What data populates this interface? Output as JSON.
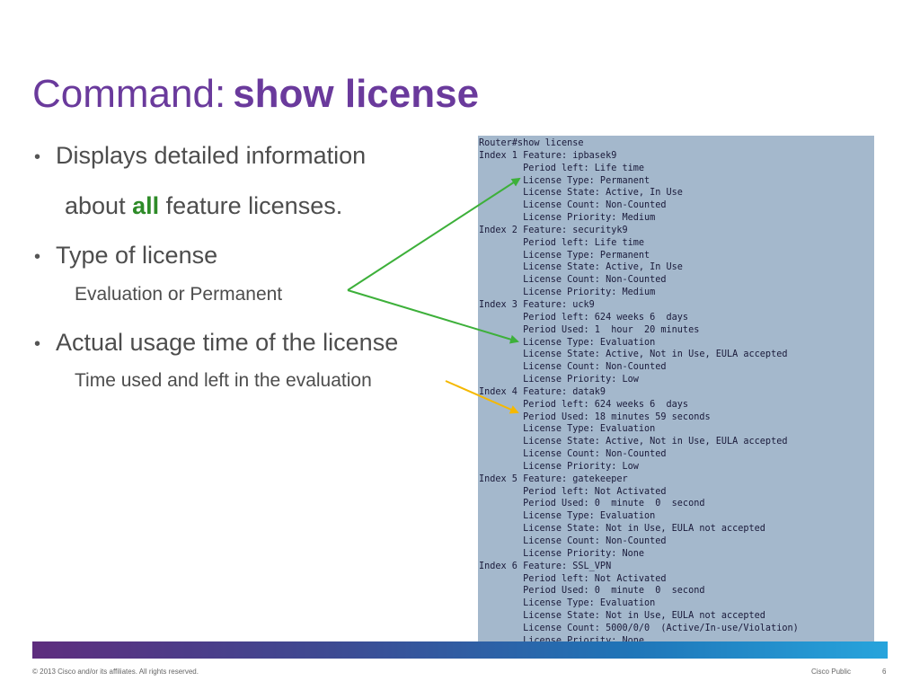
{
  "title": {
    "prefix": "Command:",
    "command": "show license"
  },
  "bullets": {
    "b1_line1": "Displays detailed information",
    "b1_line2_pre": "about ",
    "b1_line2_bold": "all",
    "b1_line2_post": " feature licenses.",
    "b2": "Type of license",
    "b2_sub": "Evaluation or Permanent",
    "b3": "Actual usage time of the license",
    "b3_sub": "Time used and left in the evaluation",
    "bullet_char": "•"
  },
  "terminal": {
    "lines": [
      "Router#show license",
      "Index 1 Feature: ipbasek9",
      "        Period left: Life time",
      "        License Type: Permanent",
      "        License State: Active, In Use",
      "        License Count: Non-Counted",
      "        License Priority: Medium",
      "Index 2 Feature: securityk9",
      "        Period left: Life time",
      "        License Type: Permanent",
      "        License State: Active, In Use",
      "        License Count: Non-Counted",
      "        License Priority: Medium",
      "Index 3 Feature: uck9",
      "        Period left: 624 weeks 6  days",
      "        Period Used: 1  hour  20 minutes",
      "        License Type: Evaluation",
      "        License State: Active, Not in Use, EULA accepted",
      "        License Count: Non-Counted",
      "        License Priority: Low",
      "Index 4 Feature: datak9",
      "        Period left: 624 weeks 6  days",
      "        Period Used: 18 minutes 59 seconds",
      "        License Type: Evaluation",
      "        License State: Active, Not in Use, EULA accepted",
      "        License Count: Non-Counted",
      "        License Priority: Low",
      "Index 5 Feature: gatekeeper",
      "        Period left: Not Activated",
      "        Period Used: 0  minute  0  second",
      "        License Type: Evaluation",
      "        License State: Not in Use, EULA not accepted",
      "        License Count: Non-Counted",
      "        License Priority: None",
      "Index 6 Feature: SSL_VPN",
      "        Period left: Not Activated",
      "        Period Used: 0  minute  0  second",
      "        License Type: Evaluation",
      "        License State: Not in Use, EULA not accepted",
      "        License Count: 5000/0/0  (Active/In-use/Violation)",
      "        License Priority: None"
    ]
  },
  "footer": {
    "copyright": "© 2013 Cisco and/or its affiliates. All rights reserved.",
    "classification": "Cisco Public",
    "page": "6"
  },
  "colors": {
    "title": "#6a3a9c",
    "highlight": "#2e8b28",
    "green_arrow": "#3db03a",
    "yellow_arrow": "#f5b800",
    "terminal_bg": "#a4b8cc"
  }
}
